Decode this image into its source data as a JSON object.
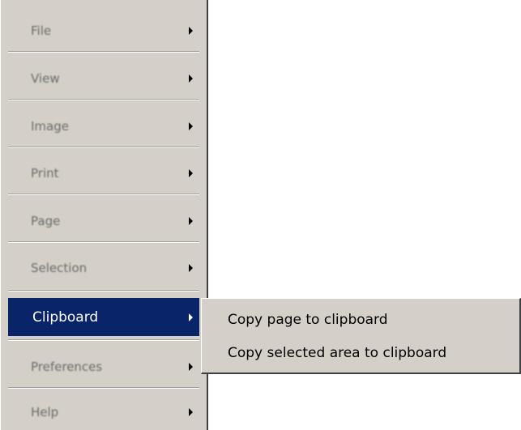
{
  "menu": {
    "items": [
      {
        "label": "File",
        "has_submenu": true,
        "highlighted": false
      },
      {
        "label": "View",
        "has_submenu": true,
        "highlighted": false
      },
      {
        "label": "Image",
        "has_submenu": true,
        "highlighted": false
      },
      {
        "label": "Print",
        "has_submenu": true,
        "highlighted": false
      },
      {
        "label": "Page",
        "has_submenu": true,
        "highlighted": false
      },
      {
        "label": "Selection",
        "has_submenu": true,
        "highlighted": false
      },
      {
        "label": "Clipboard",
        "has_submenu": true,
        "highlighted": true
      },
      {
        "label": "Preferences",
        "has_submenu": true,
        "highlighted": false
      },
      {
        "label": "Help",
        "has_submenu": true,
        "highlighted": false
      }
    ]
  },
  "submenu": {
    "items": [
      {
        "label": "Copy page to clipboard"
      },
      {
        "label": "Copy selected area to clipboard"
      }
    ]
  },
  "colors": {
    "menu_background": "#d4d0c8",
    "highlight": "#0a246a",
    "highlight_text": "#ffffff",
    "text": "#000000",
    "disabled_text": "#6a6a6a"
  },
  "icons": {
    "submenu_arrow": "chevron-right-icon"
  }
}
